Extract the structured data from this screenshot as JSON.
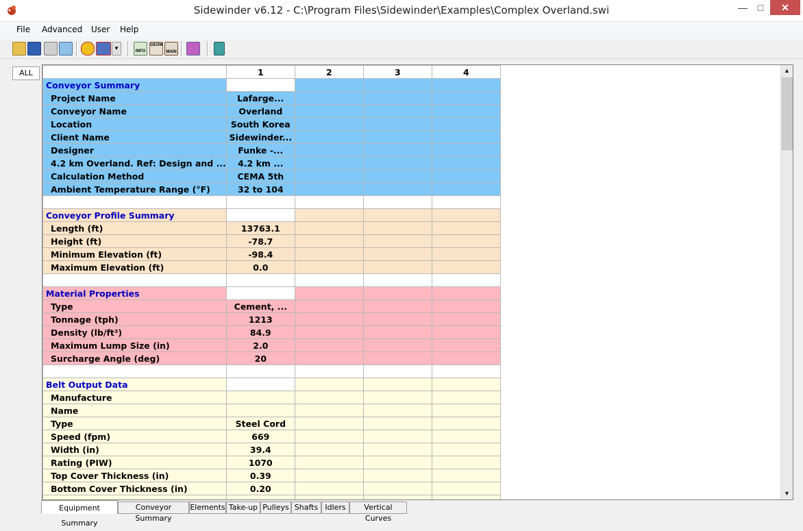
{
  "window": {
    "title": "Sidewinder v6.12 - C:\\Program Files\\Sidewinder\\Examples\\Complex Overland.swi"
  },
  "menu": [
    "File",
    "Advanced",
    "User",
    "Help"
  ],
  "toolbar": {
    "icons": [
      "open-icon",
      "save-icon",
      "print-icon",
      "edit-icon",
      "units-icon",
      "flag-icon",
      "dropdown-arrow-icon",
      "info-icon",
      "geom-icon",
      "main-icon",
      "report-icon",
      "calculator-icon"
    ],
    "info_label": "INFO",
    "geom_label": "GEOM",
    "main_label": "MAIN"
  },
  "side_tab": "ALL",
  "grid": {
    "columns": [
      "1",
      "2",
      "3",
      "4"
    ],
    "rows": [
      {
        "type": "section",
        "label": "Conveyor Summary",
        "color": "#80c8f8",
        "values": [
          "",
          "",
          "",
          ""
        ]
      },
      {
        "type": "row",
        "label": "Project Name",
        "color": "#80c8f8",
        "values": [
          "Lafarge...",
          "",
          "",
          ""
        ]
      },
      {
        "type": "row",
        "label": "Conveyor Name",
        "color": "#80c8f8",
        "values": [
          "Overland",
          "",
          "",
          ""
        ]
      },
      {
        "type": "row",
        "label": "Location",
        "color": "#80c8f8",
        "values": [
          "South Korea",
          "",
          "",
          ""
        ]
      },
      {
        "type": "row",
        "label": "Client Name",
        "color": "#80c8f8",
        "values": [
          "Sidewinder...",
          "",
          "",
          ""
        ]
      },
      {
        "type": "row",
        "label": "Designer",
        "color": "#80c8f8",
        "values": [
          "Funke -...",
          "",
          "",
          ""
        ]
      },
      {
        "type": "row",
        "label": "4.2 km Overland. Ref: Design and ...",
        "color": "#80c8f8",
        "values": [
          "4.2 km ...",
          "",
          "",
          ""
        ]
      },
      {
        "type": "row",
        "label": "Calculation Method",
        "color": "#80c8f8",
        "values": [
          "CEMA 5th",
          "",
          "",
          ""
        ]
      },
      {
        "type": "row",
        "label": "Ambient Temperature Range (°F)",
        "color": "#80c8f8",
        "values": [
          "32 to 104",
          "",
          "",
          ""
        ]
      },
      {
        "type": "blank",
        "label": "",
        "color": "#ffffff",
        "values": [
          "",
          "",
          "",
          ""
        ]
      },
      {
        "type": "section",
        "label": "Conveyor Profile Summary",
        "color": "#fce4c8",
        "values": [
          "",
          "",
          "",
          ""
        ]
      },
      {
        "type": "row",
        "label": "Length (ft)",
        "color": "#fce4c8",
        "values": [
          "13763.1",
          "",
          "",
          ""
        ]
      },
      {
        "type": "row",
        "label": "Height (ft)",
        "color": "#fce4c8",
        "values": [
          "-78.7",
          "",
          "",
          ""
        ]
      },
      {
        "type": "row",
        "label": "Minimum Elevation (ft)",
        "color": "#fce4c8",
        "values": [
          "-98.4",
          "",
          "",
          ""
        ]
      },
      {
        "type": "row",
        "label": "Maximum Elevation (ft)",
        "color": "#fce4c8",
        "values": [
          "0.0",
          "",
          "",
          ""
        ]
      },
      {
        "type": "blank",
        "label": "",
        "color": "#ffffff",
        "values": [
          "",
          "",
          "",
          ""
        ]
      },
      {
        "type": "section",
        "label": "Material Properties",
        "color": "#ffb8c0",
        "values": [
          "",
          "",
          "",
          ""
        ]
      },
      {
        "type": "row",
        "label": "Type",
        "color": "#ffb8c0",
        "values": [
          "Cement, ...",
          "",
          "",
          ""
        ]
      },
      {
        "type": "row",
        "label": "Tonnage (tph)",
        "color": "#ffb8c0",
        "values": [
          "1213",
          "",
          "",
          ""
        ]
      },
      {
        "type": "row",
        "label": "Density (lb/ft³)",
        "color": "#ffb8c0",
        "values": [
          "84.9",
          "",
          "",
          ""
        ]
      },
      {
        "type": "row",
        "label": "Maximum Lump Size (in)",
        "color": "#ffb8c0",
        "values": [
          "2.0",
          "",
          "",
          ""
        ]
      },
      {
        "type": "row",
        "label": "Surcharge Angle (deg)",
        "color": "#ffb8c0",
        "values": [
          "20",
          "",
          "",
          ""
        ]
      },
      {
        "type": "blank",
        "label": "",
        "color": "#ffffff",
        "values": [
          "",
          "",
          "",
          ""
        ]
      },
      {
        "type": "section",
        "label": "Belt Output Data",
        "color": "#fffce0",
        "values": [
          "",
          "",
          "",
          ""
        ]
      },
      {
        "type": "row",
        "label": "Manufacture",
        "color": "#fffce0",
        "values": [
          "",
          "",
          "",
          ""
        ]
      },
      {
        "type": "row",
        "label": "Name",
        "color": "#fffce0",
        "values": [
          "",
          "",
          "",
          ""
        ]
      },
      {
        "type": "row",
        "label": "Type",
        "color": "#fffce0",
        "values": [
          "Steel Cord",
          "",
          "",
          ""
        ]
      },
      {
        "type": "row",
        "label": "Speed (fpm)",
        "color": "#fffce0",
        "values": [
          "669",
          "",
          "",
          ""
        ]
      },
      {
        "type": "row",
        "label": "Width (in)",
        "color": "#fffce0",
        "values": [
          "39.4",
          "",
          "",
          ""
        ]
      },
      {
        "type": "row",
        "label": "Rating (PIW)",
        "color": "#fffce0",
        "values": [
          "1070",
          "",
          "",
          ""
        ]
      },
      {
        "type": "row",
        "label": "Top Cover Thickness (in)",
        "color": "#fffce0",
        "values": [
          "0.39",
          "",
          "",
          ""
        ]
      },
      {
        "type": "row",
        "label": "Bottom Cover Thickness (in)",
        "color": "#fffce0",
        "values": [
          "0.20",
          "",
          "",
          ""
        ]
      },
      {
        "type": "row",
        "label": "",
        "color": "#fffce0",
        "values": [
          "",
          "",
          "",
          ""
        ]
      }
    ]
  },
  "bottom_tabs": [
    {
      "label": "Equipment Summary",
      "active": true
    },
    {
      "label": "Conveyor Summary",
      "active": false
    },
    {
      "label": "Elements",
      "active": false
    },
    {
      "label": "Take-up",
      "active": false
    },
    {
      "label": "Pulleys",
      "active": false
    },
    {
      "label": "Shafts",
      "active": false
    },
    {
      "label": "Idlers",
      "active": false
    },
    {
      "label": "Vertical Curves",
      "active": false
    }
  ]
}
